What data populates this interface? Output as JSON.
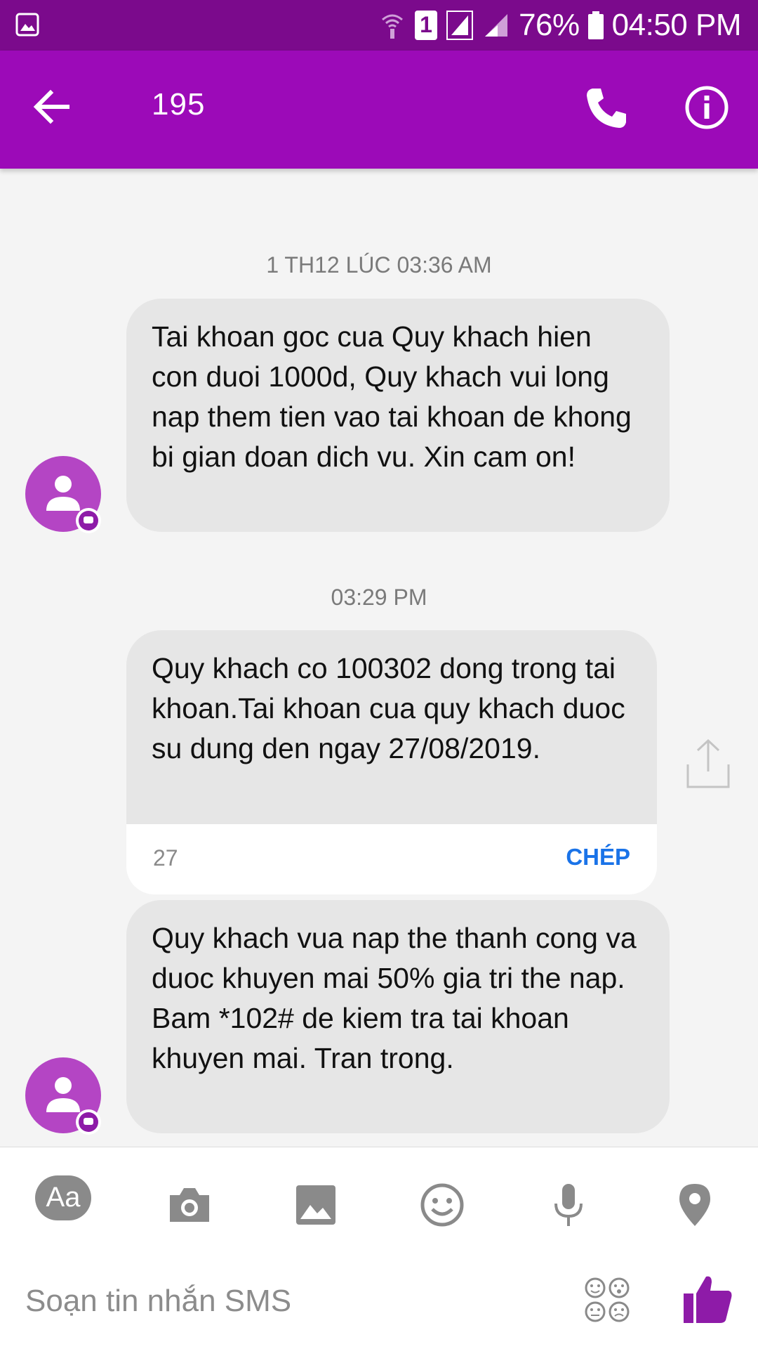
{
  "status_bar": {
    "battery": "76%",
    "time": "04:50 PM",
    "sim_slot": "1",
    "colors": {
      "background": "#7b0a8c"
    }
  },
  "app_bar": {
    "title": "195",
    "colors": {
      "background": "#9c0ab8"
    }
  },
  "messages": {
    "ts1": "1 TH12 LÚC 03:36 AM",
    "msg1": "Tai khoan goc cua Quy khach hien con duoi 1000d, Quy khach vui long nap them tien vao tai khoan de khong bi gian doan dich vu. Xin cam on!",
    "ts2": "03:29 PM",
    "msg2_prefix": "Quy khach co ",
    "msg2_amount": "100302",
    "msg2_suffix": " dong trong tai khoan.Tai khoan cua quy khach duoc su dung den ngay 27/08/2019.",
    "msg2_char_count": "27",
    "msg2_copy_label": "CHÉP",
    "msg3": "Quy khach vua nap the thanh cong va duoc khuyen mai 50% gia tri the nap. Bam *102# de kiem tra tai khoan khuyen mai. Tran trong."
  },
  "composer": {
    "aa_label": "Aa",
    "placeholder": "Soạn tin nhắn SMS",
    "accent_color": "#8e1ba8"
  },
  "icons": [
    "gallery-icon",
    "wifi-call-icon",
    "sim-icon",
    "signal-icon",
    "battery-icon",
    "back-arrow-icon",
    "phone-icon",
    "info-icon",
    "person-icon",
    "share-icon",
    "camera-icon",
    "image-icon",
    "emoji-icon",
    "mic-icon",
    "location-icon",
    "stickers-icon",
    "thumbs-up-icon"
  ]
}
